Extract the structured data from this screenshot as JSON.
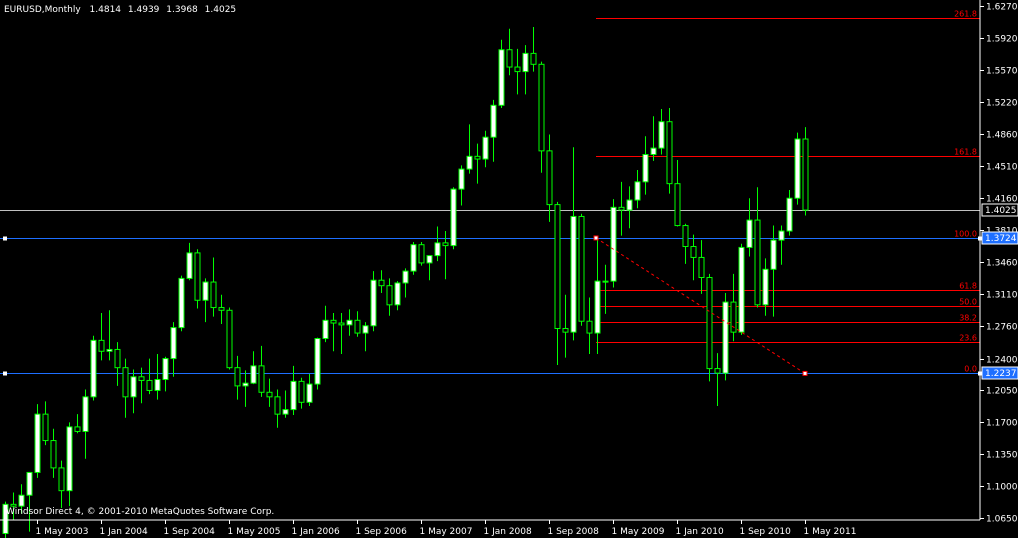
{
  "chart_data": {
    "type": "candlestick",
    "header": {
      "symbol_period": "EURUSD,Monthly",
      "open": "1.4814",
      "high": "1.4939",
      "low": "1.3968",
      "close": "1.4025"
    },
    "footer": "Windsor Direct 4, © 2001-2010 MetaQuotes Software Corp.",
    "y_ticks": [
      "1.6270",
      "1.5920",
      "1.5570",
      "1.5220",
      "1.4860",
      "1.4510",
      "1.4160",
      "1.3810",
      "1.3460",
      "1.3110",
      "1.2760",
      "1.2400",
      "1.2050",
      "1.1700",
      "1.1350",
      "1.1000",
      "1.0650"
    ],
    "x_ticks": [
      "1 May 2003",
      "1 Jan 2004",
      "1 Sep 2004",
      "1 May 2005",
      "1 Jan 2006",
      "1 Sep 2006",
      "1 May 2007",
      "1 Jan 2008",
      "1 Sep 2008",
      "1 May 2009",
      "1 Jan 2010",
      "1 Sep 2010",
      "1 May 2011"
    ],
    "ylim": [
      1.065,
      1.627
    ],
    "current_price_label": "1.4025",
    "horizontal_lines": [
      {
        "value": 1.3724,
        "label": "1.3724"
      },
      {
        "value": 1.2237,
        "label": "1.2237"
      }
    ],
    "fibonacci": {
      "levels": [
        {
          "label": "261.8",
          "value": 1.6135
        },
        {
          "label": "161.8",
          "value": 1.4626
        },
        {
          "label": "100.0",
          "value": 1.3724
        },
        {
          "label": "61.8",
          "value": 1.3157
        },
        {
          "label": "50.0",
          "value": 1.2981
        },
        {
          "label": "38.2",
          "value": 1.2805
        },
        {
          "label": "23.6",
          "value": 1.2587
        },
        {
          "label": "0.0",
          "value": 1.2237
        }
      ],
      "trend_line": {
        "from": {
          "date": "1 May 2009",
          "value": 1.3724
        },
        "to": {
          "date": "Jun 2011",
          "value": 1.2237
        }
      }
    },
    "candles": [
      {
        "date": "2003-01",
        "o": 1.048,
        "h": 1.083,
        "l": 1.04,
        "c": 1.08
      },
      {
        "date": "2003-02",
        "o": 1.08,
        "h": 1.093,
        "l": 1.063,
        "c": 1.078
      },
      {
        "date": "2003-03",
        "o": 1.078,
        "h": 1.102,
        "l": 1.07,
        "c": 1.09
      },
      {
        "date": "2003-04",
        "o": 1.09,
        "h": 1.115,
        "l": 1.05,
        "c": 1.115
      },
      {
        "date": "2003-05",
        "o": 1.115,
        "h": 1.19,
        "l": 1.109,
        "c": 1.179
      },
      {
        "date": "2003-06",
        "o": 1.179,
        "h": 1.193,
        "l": 1.145,
        "c": 1.15
      },
      {
        "date": "2003-07",
        "o": 1.15,
        "h": 1.163,
        "l": 1.109,
        "c": 1.12
      },
      {
        "date": "2003-08",
        "o": 1.12,
        "h": 1.128,
        "l": 1.076,
        "c": 1.095
      },
      {
        "date": "2003-09",
        "o": 1.095,
        "h": 1.17,
        "l": 1.078,
        "c": 1.165
      },
      {
        "date": "2003-10",
        "o": 1.165,
        "h": 1.179,
        "l": 1.158,
        "c": 1.16
      },
      {
        "date": "2003-11",
        "o": 1.16,
        "h": 1.206,
        "l": 1.13,
        "c": 1.198
      },
      {
        "date": "2003-12",
        "o": 1.198,
        "h": 1.265,
        "l": 1.194,
        "c": 1.26
      },
      {
        "date": "2004-01",
        "o": 1.26,
        "h": 1.29,
        "l": 1.238,
        "c": 1.248
      },
      {
        "date": "2004-02",
        "o": 1.248,
        "h": 1.293,
        "l": 1.238,
        "c": 1.25
      },
      {
        "date": "2004-03",
        "o": 1.25,
        "h": 1.258,
        "l": 1.21,
        "c": 1.23
      },
      {
        "date": "2004-04",
        "o": 1.23,
        "h": 1.24,
        "l": 1.175,
        "c": 1.198
      },
      {
        "date": "2004-05",
        "o": 1.198,
        "h": 1.228,
        "l": 1.18,
        "c": 1.22
      },
      {
        "date": "2004-06",
        "o": 1.22,
        "h": 1.23,
        "l": 1.191,
        "c": 1.216
      },
      {
        "date": "2004-07",
        "o": 1.216,
        "h": 1.24,
        "l": 1.201,
        "c": 1.205
      },
      {
        "date": "2004-08",
        "o": 1.205,
        "h": 1.245,
        "l": 1.195,
        "c": 1.217
      },
      {
        "date": "2004-09",
        "o": 1.217,
        "h": 1.242,
        "l": 1.204,
        "c": 1.24
      },
      {
        "date": "2004-10",
        "o": 1.24,
        "h": 1.28,
        "l": 1.22,
        "c": 1.274
      },
      {
        "date": "2004-11",
        "o": 1.274,
        "h": 1.331,
        "l": 1.27,
        "c": 1.328
      },
      {
        "date": "2004-12",
        "o": 1.328,
        "h": 1.367,
        "l": 1.326,
        "c": 1.356
      },
      {
        "date": "2005-01",
        "o": 1.356,
        "h": 1.36,
        "l": 1.295,
        "c": 1.304
      },
      {
        "date": "2005-02",
        "o": 1.304,
        "h": 1.328,
        "l": 1.28,
        "c": 1.324
      },
      {
        "date": "2005-03",
        "o": 1.324,
        "h": 1.351,
        "l": 1.286,
        "c": 1.296
      },
      {
        "date": "2005-04",
        "o": 1.296,
        "h": 1.31,
        "l": 1.278,
        "c": 1.293
      },
      {
        "date": "2005-05",
        "o": 1.293,
        "h": 1.296,
        "l": 1.228,
        "c": 1.23
      },
      {
        "date": "2005-06",
        "o": 1.23,
        "h": 1.243,
        "l": 1.195,
        "c": 1.21
      },
      {
        "date": "2005-07",
        "o": 1.21,
        "h": 1.227,
        "l": 1.187,
        "c": 1.213
      },
      {
        "date": "2005-08",
        "o": 1.213,
        "h": 1.248,
        "l": 1.212,
        "c": 1.232
      },
      {
        "date": "2005-09",
        "o": 1.232,
        "h": 1.254,
        "l": 1.198,
        "c": 1.203
      },
      {
        "date": "2005-10",
        "o": 1.203,
        "h": 1.218,
        "l": 1.187,
        "c": 1.198
      },
      {
        "date": "2005-11",
        "o": 1.198,
        "h": 1.206,
        "l": 1.164,
        "c": 1.179
      },
      {
        "date": "2005-12",
        "o": 1.179,
        "h": 1.205,
        "l": 1.175,
        "c": 1.184
      },
      {
        "date": "2006-01",
        "o": 1.184,
        "h": 1.232,
        "l": 1.178,
        "c": 1.215
      },
      {
        "date": "2006-02",
        "o": 1.215,
        "h": 1.219,
        "l": 1.185,
        "c": 1.192
      },
      {
        "date": "2006-03",
        "o": 1.192,
        "h": 1.223,
        "l": 1.188,
        "c": 1.212
      },
      {
        "date": "2006-04",
        "o": 1.212,
        "h": 1.263,
        "l": 1.206,
        "c": 1.262
      },
      {
        "date": "2006-05",
        "o": 1.262,
        "h": 1.298,
        "l": 1.258,
        "c": 1.282
      },
      {
        "date": "2006-06",
        "o": 1.282,
        "h": 1.29,
        "l": 1.248,
        "c": 1.279
      },
      {
        "date": "2006-07",
        "o": 1.279,
        "h": 1.29,
        "l": 1.245,
        "c": 1.277
      },
      {
        "date": "2006-08",
        "o": 1.277,
        "h": 1.294,
        "l": 1.265,
        "c": 1.282
      },
      {
        "date": "2006-09",
        "o": 1.282,
        "h": 1.292,
        "l": 1.264,
        "c": 1.268
      },
      {
        "date": "2006-10",
        "o": 1.268,
        "h": 1.28,
        "l": 1.248,
        "c": 1.276
      },
      {
        "date": "2006-11",
        "o": 1.276,
        "h": 1.336,
        "l": 1.27,
        "c": 1.326
      },
      {
        "date": "2006-12",
        "o": 1.326,
        "h": 1.337,
        "l": 1.312,
        "c": 1.32
      },
      {
        "date": "2007-01",
        "o": 1.32,
        "h": 1.328,
        "l": 1.287,
        "c": 1.299
      },
      {
        "date": "2007-02",
        "o": 1.299,
        "h": 1.325,
        "l": 1.293,
        "c": 1.323
      },
      {
        "date": "2007-03",
        "o": 1.323,
        "h": 1.339,
        "l": 1.307,
        "c": 1.336
      },
      {
        "date": "2007-04",
        "o": 1.336,
        "h": 1.368,
        "l": 1.332,
        "c": 1.365
      },
      {
        "date": "2007-05",
        "o": 1.365,
        "h": 1.368,
        "l": 1.342,
        "c": 1.345
      },
      {
        "date": "2007-06",
        "o": 1.345,
        "h": 1.352,
        "l": 1.326,
        "c": 1.353
      },
      {
        "date": "2007-07",
        "o": 1.353,
        "h": 1.385,
        "l": 1.347,
        "c": 1.367
      },
      {
        "date": "2007-08",
        "o": 1.367,
        "h": 1.38,
        "l": 1.327,
        "c": 1.364
      },
      {
        "date": "2007-09",
        "o": 1.364,
        "h": 1.428,
        "l": 1.36,
        "c": 1.426
      },
      {
        "date": "2007-10",
        "o": 1.426,
        "h": 1.452,
        "l": 1.408,
        "c": 1.448
      },
      {
        "date": "2007-11",
        "o": 1.448,
        "h": 1.497,
        "l": 1.443,
        "c": 1.462
      },
      {
        "date": "2007-12",
        "o": 1.462,
        "h": 1.476,
        "l": 1.432,
        "c": 1.459
      },
      {
        "date": "2008-01",
        "o": 1.459,
        "h": 1.49,
        "l": 1.45,
        "c": 1.483
      },
      {
        "date": "2008-02",
        "o": 1.483,
        "h": 1.524,
        "l": 1.456,
        "c": 1.518
      },
      {
        "date": "2008-03",
        "o": 1.518,
        "h": 1.59,
        "l": 1.515,
        "c": 1.579
      },
      {
        "date": "2008-04",
        "o": 1.579,
        "h": 1.602,
        "l": 1.551,
        "c": 1.56
      },
      {
        "date": "2008-05",
        "o": 1.56,
        "h": 1.58,
        "l": 1.53,
        "c": 1.555
      },
      {
        "date": "2008-06",
        "o": 1.555,
        "h": 1.584,
        "l": 1.53,
        "c": 1.575
      },
      {
        "date": "2008-07",
        "o": 1.575,
        "h": 1.604,
        "l": 1.555,
        "c": 1.563
      },
      {
        "date": "2008-08",
        "o": 1.563,
        "h": 1.566,
        "l": 1.444,
        "c": 1.468
      },
      {
        "date": "2008-09",
        "o": 1.468,
        "h": 1.486,
        "l": 1.39,
        "c": 1.409
      },
      {
        "date": "2008-10",
        "o": 1.409,
        "h": 1.412,
        "l": 1.233,
        "c": 1.273
      },
      {
        "date": "2008-11",
        "o": 1.273,
        "h": 1.31,
        "l": 1.241,
        "c": 1.269
      },
      {
        "date": "2008-12",
        "o": 1.269,
        "h": 1.472,
        "l": 1.26,
        "c": 1.396
      },
      {
        "date": "2009-01",
        "o": 1.396,
        "h": 1.399,
        "l": 1.276,
        "c": 1.281
      },
      {
        "date": "2009-02",
        "o": 1.281,
        "h": 1.307,
        "l": 1.245,
        "c": 1.268
      },
      {
        "date": "2009-03",
        "o": 1.268,
        "h": 1.374,
        "l": 1.245,
        "c": 1.325
      },
      {
        "date": "2009-04",
        "o": 1.325,
        "h": 1.343,
        "l": 1.289,
        "c": 1.325
      },
      {
        "date": "2009-05",
        "o": 1.325,
        "h": 1.415,
        "l": 1.318,
        "c": 1.406
      },
      {
        "date": "2009-06",
        "o": 1.406,
        "h": 1.434,
        "l": 1.375,
        "c": 1.403
      },
      {
        "date": "2009-07",
        "o": 1.403,
        "h": 1.429,
        "l": 1.383,
        "c": 1.414
      },
      {
        "date": "2009-08",
        "o": 1.414,
        "h": 1.447,
        "l": 1.405,
        "c": 1.434
      },
      {
        "date": "2009-09",
        "o": 1.434,
        "h": 1.484,
        "l": 1.42,
        "c": 1.464
      },
      {
        "date": "2009-10",
        "o": 1.464,
        "h": 1.506,
        "l": 1.457,
        "c": 1.471
      },
      {
        "date": "2009-11",
        "o": 1.471,
        "h": 1.514,
        "l": 1.464,
        "c": 1.5
      },
      {
        "date": "2009-12",
        "o": 1.5,
        "h": 1.515,
        "l": 1.421,
        "c": 1.432
      },
      {
        "date": "2010-01",
        "o": 1.432,
        "h": 1.458,
        "l": 1.385,
        "c": 1.386
      },
      {
        "date": "2010-02",
        "o": 1.386,
        "h": 1.388,
        "l": 1.344,
        "c": 1.363
      },
      {
        "date": "2010-03",
        "o": 1.363,
        "h": 1.376,
        "l": 1.326,
        "c": 1.351
      },
      {
        "date": "2010-04",
        "o": 1.351,
        "h": 1.37,
        "l": 1.311,
        "c": 1.329
      },
      {
        "date": "2010-05",
        "o": 1.329,
        "h": 1.333,
        "l": 1.215,
        "c": 1.229
      },
      {
        "date": "2010-06",
        "o": 1.229,
        "h": 1.246,
        "l": 1.188,
        "c": 1.224
      },
      {
        "date": "2010-07",
        "o": 1.224,
        "h": 1.312,
        "l": 1.216,
        "c": 1.302
      },
      {
        "date": "2010-08",
        "o": 1.302,
        "h": 1.333,
        "l": 1.259,
        "c": 1.269
      },
      {
        "date": "2010-09",
        "o": 1.269,
        "h": 1.366,
        "l": 1.266,
        "c": 1.362
      },
      {
        "date": "2010-10",
        "o": 1.362,
        "h": 1.416,
        "l": 1.352,
        "c": 1.392
      },
      {
        "date": "2010-11",
        "o": 1.392,
        "h": 1.428,
        "l": 1.296,
        "c": 1.299
      },
      {
        "date": "2010-12",
        "o": 1.299,
        "h": 1.35,
        "l": 1.287,
        "c": 1.338
      },
      {
        "date": "2011-01",
        "o": 1.338,
        "h": 1.386,
        "l": 1.286,
        "c": 1.37
      },
      {
        "date": "2011-02",
        "o": 1.37,
        "h": 1.386,
        "l": 1.343,
        "c": 1.38
      },
      {
        "date": "2011-03",
        "o": 1.38,
        "h": 1.425,
        "l": 1.375,
        "c": 1.416
      },
      {
        "date": "2011-04",
        "o": 1.416,
        "h": 1.488,
        "l": 1.409,
        "c": 1.481
      },
      {
        "date": "2011-05",
        "o": 1.481,
        "h": 1.494,
        "l": 1.397,
        "c": 1.403
      }
    ],
    "colors": {
      "background": "#000000",
      "bull_body": "#ffffff",
      "bear_body": "#000000",
      "candle_outline": "#00ff00",
      "wick": "#00ff00",
      "fib_line": "#ff0000",
      "fib_label": "#ff0000",
      "trend_line": "#ff0000",
      "blue_line": "#1e6fff",
      "current_line": "#c0c0c0",
      "axis": "#ffffff",
      "label_bg_current": "#000000",
      "label_bg_blue": "#1e6fff"
    }
  }
}
